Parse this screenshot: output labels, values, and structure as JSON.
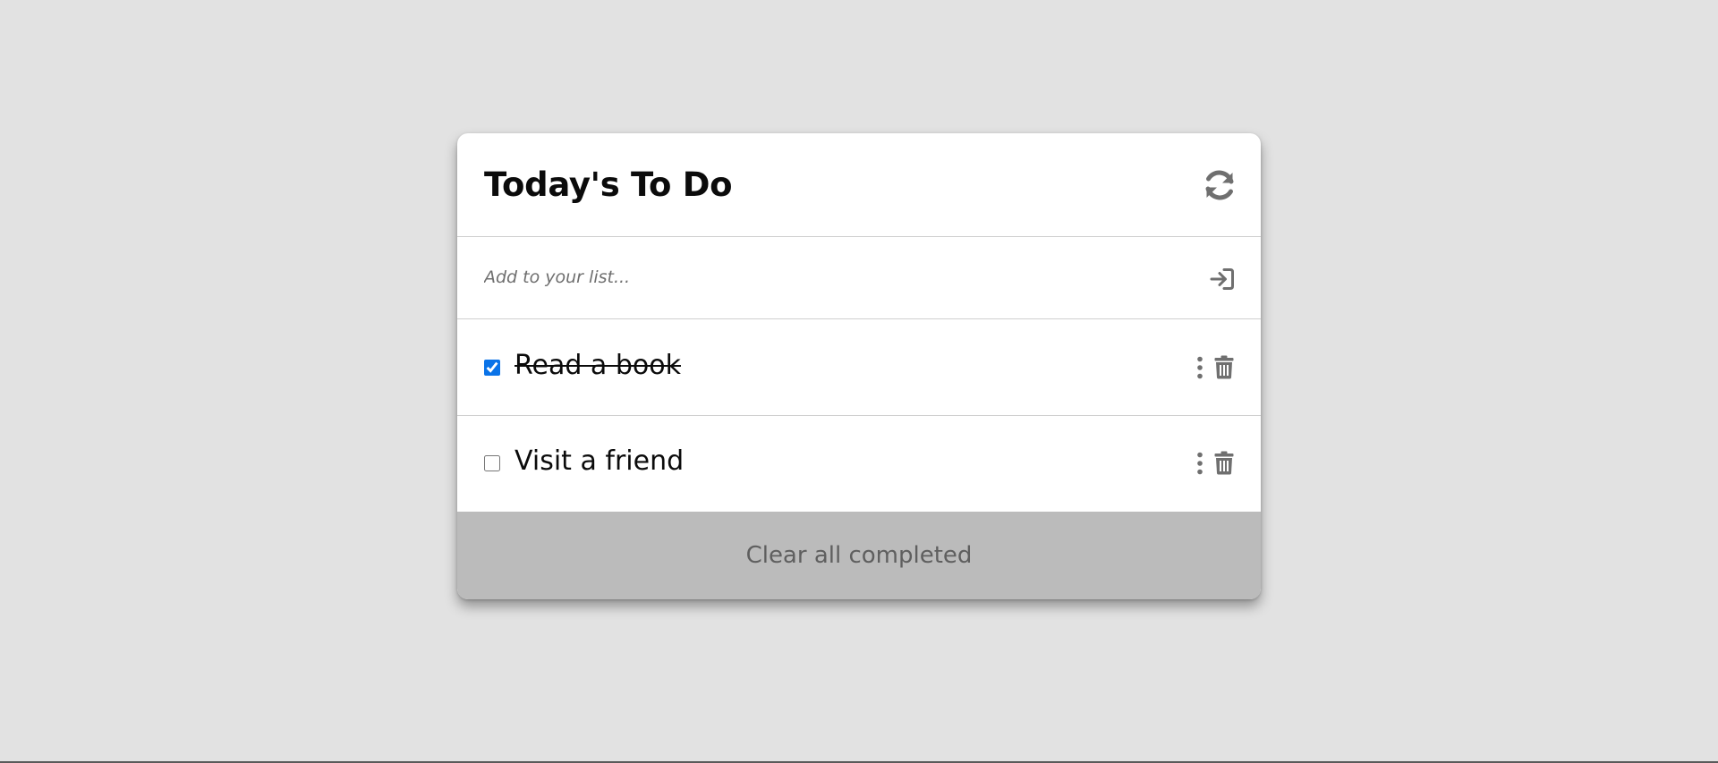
{
  "card": {
    "title": "Today's To Do",
    "refresh_icon": "refresh-icon"
  },
  "add": {
    "placeholder": "Add to your list...",
    "value": "",
    "submit_icon": "sign-in-icon"
  },
  "tasks": [
    {
      "label": "Read a book",
      "completed": true,
      "menu_icon": "kebab-menu-icon",
      "delete_icon": "trash-icon"
    },
    {
      "label": "Visit a friend",
      "completed": false,
      "menu_icon": "kebab-menu-icon",
      "delete_icon": "trash-icon"
    }
  ],
  "footer": {
    "clear_label": "Clear all completed"
  },
  "colors": {
    "page_background": "#e2e2e2",
    "card_background": "#ffffff",
    "footer_background": "#bbbbbb",
    "icon_gray": "#6f6f6f",
    "checkbox_accent": "#0a73e8"
  }
}
